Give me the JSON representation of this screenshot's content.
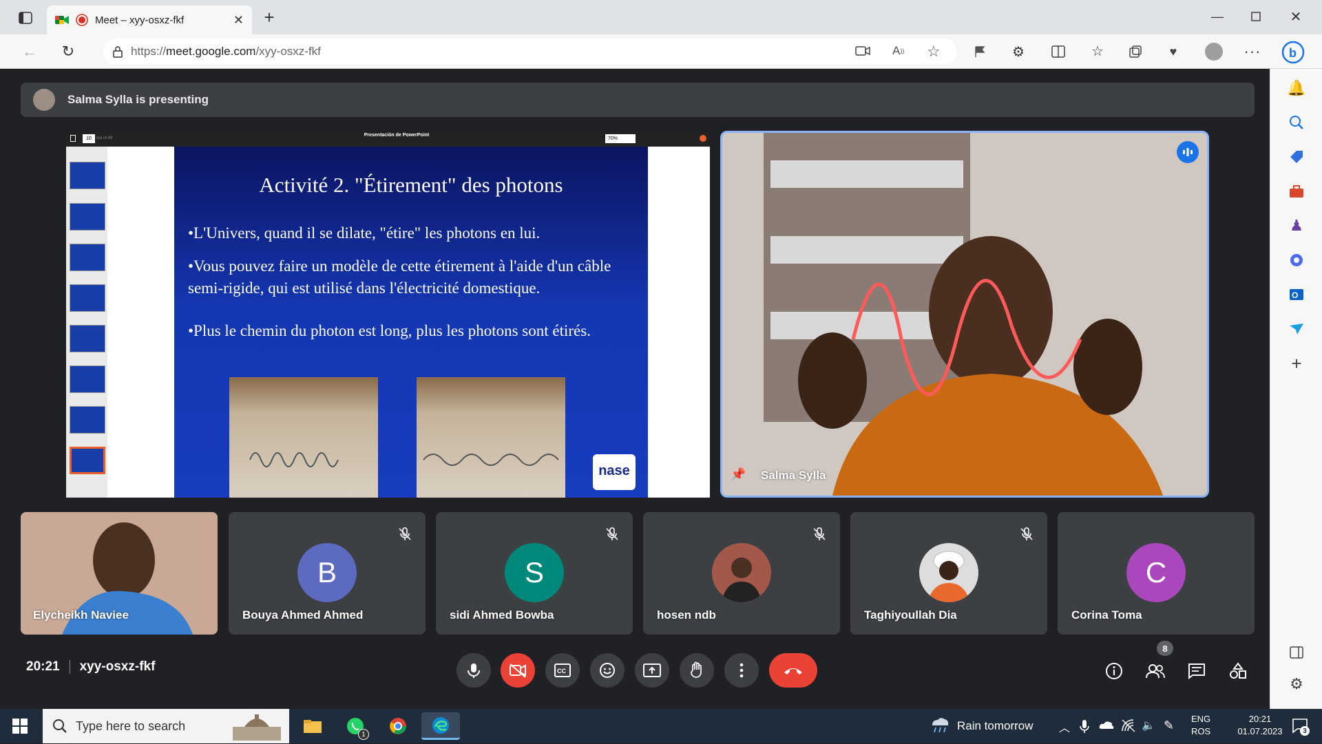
{
  "browser": {
    "tab_title": "Meet – xyy-osxz-fkf",
    "url_prefix": "https://",
    "url_host": "meet.google.com",
    "url_path": "/xyy-osxz-fkf"
  },
  "presentation_bar": {
    "text": "Salma Sylla is presenting"
  },
  "ppt": {
    "title": "Presentación de PowerPoint",
    "page": "10",
    "of_pages": "out of 49",
    "zoom": "70%"
  },
  "slide": {
    "title": "Activité 2. \"Étirement\" des photons",
    "bullets": [
      "•L'Univers, quand il se dilate, \"étire\" les photons en lui.",
      "•Vous pouvez faire un modèle de cette étirement à l'aide d'un câble semi-rigide, qui est utilisé dans l'électricité domestique.",
      "•Plus le chemin du photon est long, plus les photons  sont étirés."
    ],
    "logo": "nase"
  },
  "presenter": {
    "name": "Salma Sylla"
  },
  "participants": [
    {
      "name": "Elycheikh Naviee",
      "type": "video"
    },
    {
      "name": "Bouya Ahmed Ahmed",
      "letter": "B",
      "color": "#5c6bc0",
      "muted": true
    },
    {
      "name": "sidi Ahmed Bowba",
      "letter": "S",
      "color": "#00897b",
      "muted": true
    },
    {
      "name": "hosen ndb",
      "type": "photo",
      "muted": true
    },
    {
      "name": "Taghiyoullah Dia",
      "type": "photo",
      "muted": true
    },
    {
      "name": "Corina Toma",
      "letter": "C",
      "color": "#ab47bc"
    }
  ],
  "meeting": {
    "time": "20:21",
    "code": "xyy-osxz-fkf",
    "people_count": "8"
  },
  "taskbar": {
    "search_placeholder": "Type here to search",
    "weather": "Rain tomorrow",
    "lang_top": "ENG",
    "lang_bottom": "ROS",
    "clock_time": "20:21",
    "clock_date": "01.07.2023",
    "notif_count": "3",
    "whatsapp_badge": "1"
  },
  "colors": {
    "meet_bg": "#202124",
    "tile_bg": "#3c4043",
    "end_call": "#ea4335",
    "accent": "#8ab4f8"
  }
}
